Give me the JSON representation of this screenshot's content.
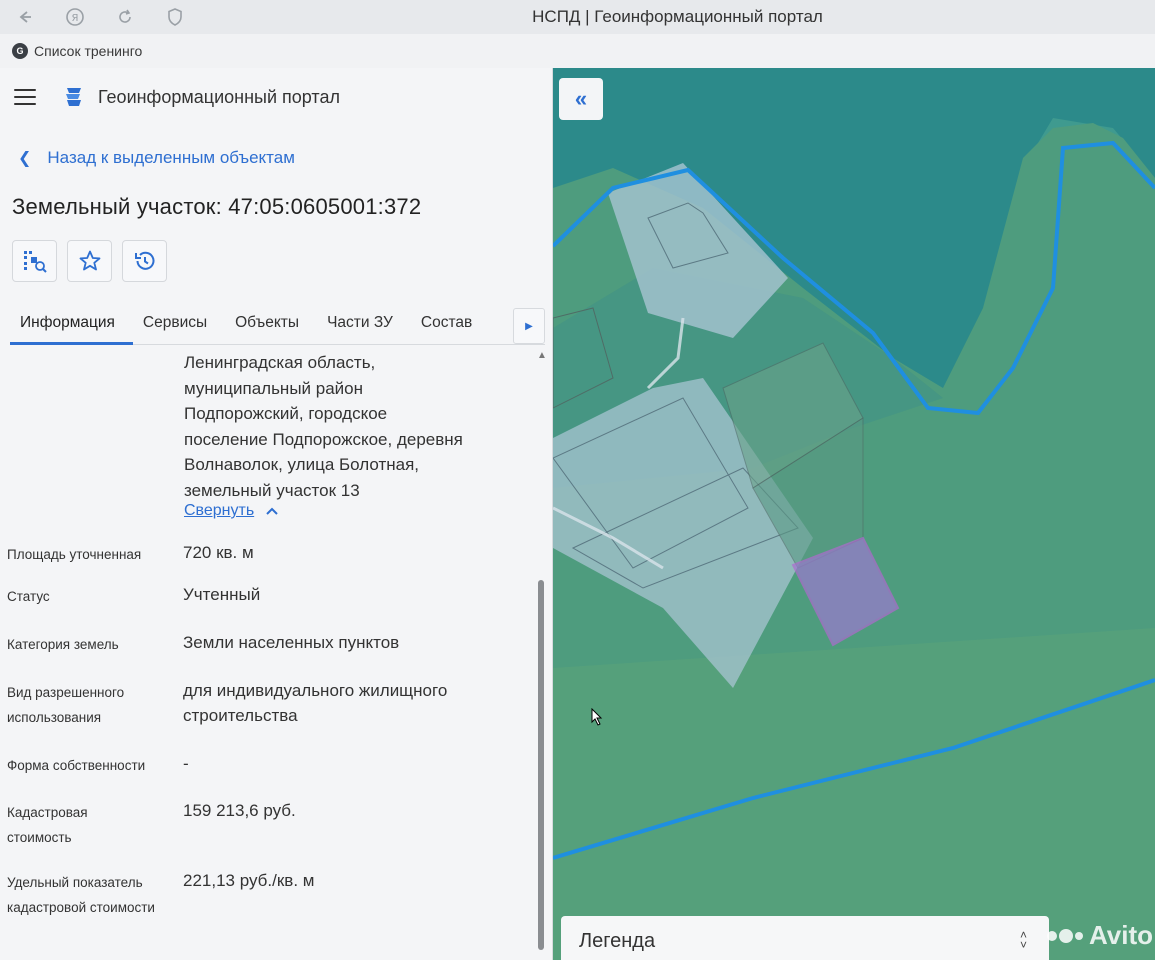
{
  "browser": {
    "title": "НСПД | Геоинформационный портал",
    "bookmark": "Список тренинго"
  },
  "app": {
    "title": "Геоинформационный портал"
  },
  "navigation": {
    "back_label": "Назад к выделенным объектам"
  },
  "object": {
    "title": "Земельный участок: 47:05:0605001:372"
  },
  "actions": [
    "select-on-map-icon",
    "star-icon",
    "history-icon"
  ],
  "tabs": [
    "Информация",
    "Сервисы",
    "Объекты",
    "Части ЗУ",
    "Состав"
  ],
  "info": {
    "address_lines": [
      "Ленинградская область,",
      "муниципальный район",
      "Подпорожский, городское",
      "поселение Подпорожское, деревня",
      "Волнаволок, улица Болотная,",
      "земельный участок 13"
    ],
    "collapse_label": "Свернуть",
    "rows": [
      {
        "label": "Площадь уточненная",
        "value": "720 кв. м"
      },
      {
        "label": "Статус",
        "value": "Учтенный"
      },
      {
        "label": "Категория земель",
        "value": "Земли населенных пунктов"
      },
      {
        "label": "Вид разрешенного использования",
        "value": "для индивидуального жилищного строительства"
      },
      {
        "label": "Форма собственности",
        "value": "-"
      },
      {
        "label": "Кадастровая стоимость",
        "value": "159 213,6 руб."
      },
      {
        "label": "Удельный показатель кадастровой стоимости",
        "value": "221,13 руб./кв. м"
      }
    ]
  },
  "map": {
    "legend_label": "Легенда",
    "watermark": "Avito",
    "colors": {
      "land": "#4f9a7f",
      "forest": "#2f8a86",
      "parcel_fill": "#a8c4d2",
      "border_line": "#1f8fe0",
      "selected_parcel": "#b06ad0"
    }
  }
}
